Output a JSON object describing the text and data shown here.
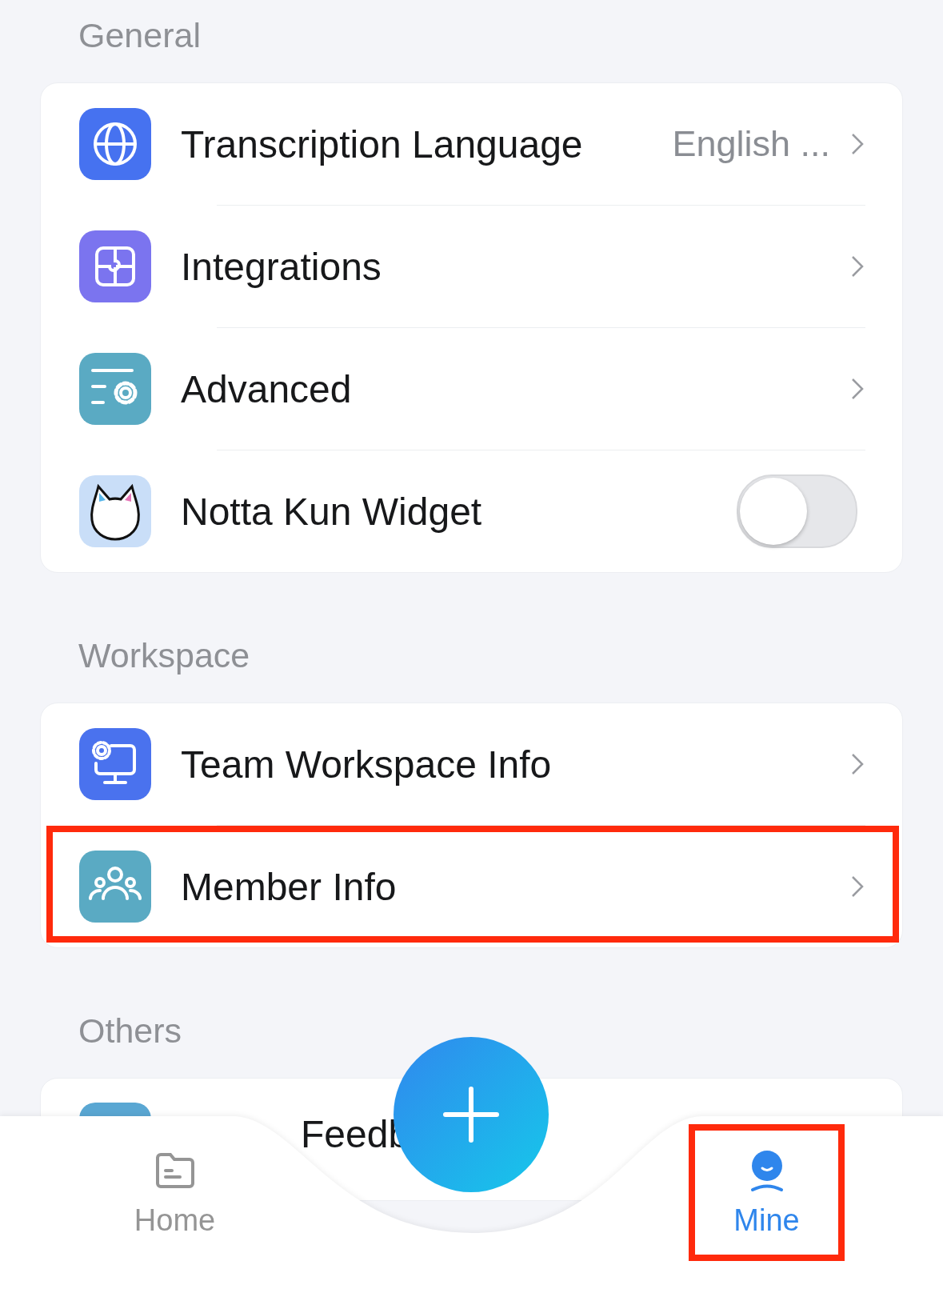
{
  "sections": [
    {
      "title": "General",
      "items": [
        {
          "kind": "link",
          "label": "Transcription Language",
          "value": "English ...",
          "highlighted": false
        },
        {
          "kind": "link",
          "label": "Integrations",
          "highlighted": false
        },
        {
          "kind": "link",
          "label": "Advanced",
          "highlighted": false
        },
        {
          "kind": "toggle",
          "label": "Notta Kun Widget",
          "on": false,
          "highlighted": false
        }
      ]
    },
    {
      "title": "Workspace",
      "items": [
        {
          "kind": "link",
          "label": "Team Workspace Info",
          "highlighted": false
        },
        {
          "kind": "link",
          "label": "Member Info",
          "highlighted": true
        }
      ]
    },
    {
      "title": "Others",
      "items": [
        {
          "kind": "plain",
          "label": "Feedb"
        }
      ]
    }
  ],
  "tabs": [
    {
      "label": "Home",
      "selected": false,
      "highlighted": false
    },
    {
      "label": "Mine",
      "selected": true,
      "highlighted": true
    }
  ]
}
